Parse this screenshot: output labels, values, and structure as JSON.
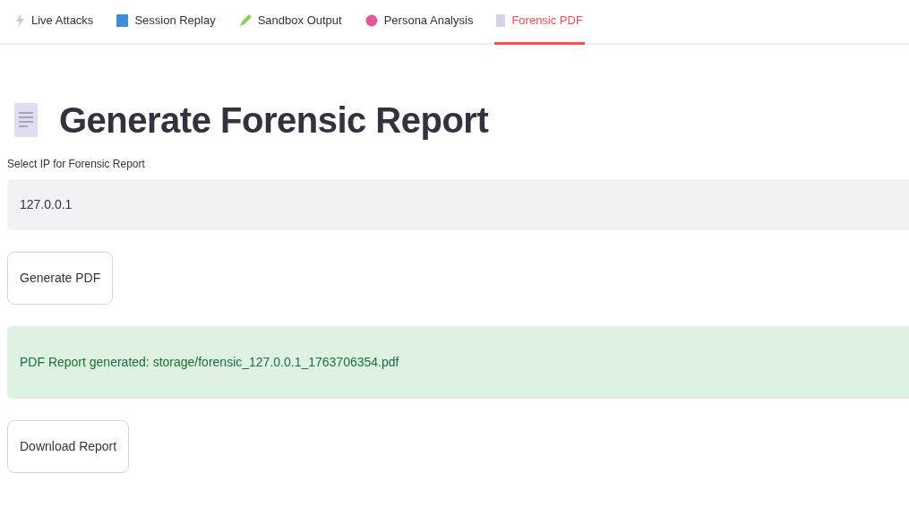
{
  "tabs": [
    {
      "label": "Live Attacks",
      "selected": false
    },
    {
      "label": "Session Replay",
      "selected": false
    },
    {
      "label": "Sandbox Output",
      "selected": false
    },
    {
      "label": "Persona Analysis",
      "selected": false
    },
    {
      "label": "Forensic PDF",
      "selected": true
    }
  ],
  "heading": "Generate Forensic Report",
  "ip_select": {
    "label": "Select IP for Forensic Report",
    "value": "127.0.0.1"
  },
  "generate_button": "Generate PDF",
  "success_message": "PDF Report generated: storage/forensic_127.0.0.1_1763706354.pdf",
  "download_button": "Download Report"
}
